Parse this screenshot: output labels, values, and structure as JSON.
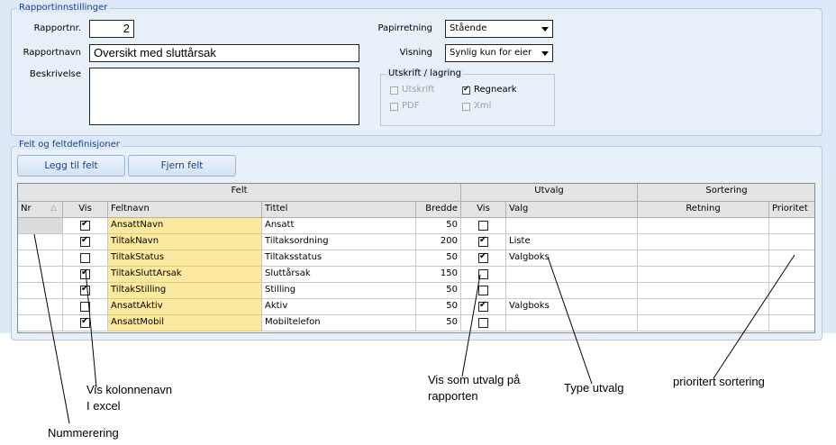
{
  "report_settings": {
    "title": "Rapportinnstillinger",
    "report_no_label": "Rapportnr.",
    "report_no_value": "2",
    "report_name_label": "Rapportnavn",
    "report_name_value": "Oversikt med sluttårsak",
    "description_label": "Beskrivelse",
    "description_value": "",
    "orientation_label": "Papirretning",
    "orientation_value": "Stående",
    "visibility_label": "Visning",
    "visibility_value": "Synlig kun for eier",
    "output": {
      "title": "Utskrift / lagring",
      "print_label": "Utskrift",
      "spreadsheet_label": "Regneark",
      "pdf_label": "PDF",
      "xml_label": "Xml"
    }
  },
  "fields": {
    "title": "Felt og feltdefinisjoner",
    "add_button": "Legg til felt",
    "remove_button": "Fjern felt",
    "grid": {
      "group_headers": {
        "felt": "Felt",
        "utvalg": "Utvalg",
        "sortering": "Sortering"
      },
      "columns": {
        "nr": "Nr",
        "vis": "Vis",
        "feltnavn": "Feltnavn",
        "tittel": "Tittel",
        "bredde": "Bredde",
        "utvalg_vis": "Vis",
        "valg": "Valg",
        "retning": "Retning",
        "prioritet": "Prioritet"
      },
      "rows": [
        {
          "vis": true,
          "feltnavn": "AnsattNavn",
          "tittel": "Ansatt",
          "bredde": "50",
          "utvalg_vis": false,
          "valg": ""
        },
        {
          "vis": true,
          "feltnavn": "TiltakNavn",
          "tittel": "Tiltaksordning",
          "bredde": "200",
          "utvalg_vis": true,
          "valg": "Liste"
        },
        {
          "vis": false,
          "feltnavn": "TiltakStatus",
          "tittel": "Tiltaksstatus",
          "bredde": "50",
          "utvalg_vis": true,
          "valg": "Valgboks"
        },
        {
          "vis": true,
          "feltnavn": "TiltakSluttArsak",
          "tittel": "Sluttårsak",
          "bredde": "150",
          "utvalg_vis": false,
          "valg": ""
        },
        {
          "vis": true,
          "feltnavn": "TiltakStilling",
          "tittel": "Stilling",
          "bredde": "50",
          "utvalg_vis": false,
          "valg": ""
        },
        {
          "vis": false,
          "feltnavn": "AnsattAktiv",
          "tittel": "Aktiv",
          "bredde": "50",
          "utvalg_vis": true,
          "valg": "Valgboks"
        },
        {
          "vis": true,
          "feltnavn": "AnsattMobil",
          "tittel": "Mobiltelefon",
          "bredde": "50",
          "utvalg_vis": false,
          "valg": ""
        }
      ]
    }
  },
  "annotations": {
    "vis_kolonne_line1": "Vis kolonnenavn",
    "vis_kolonne_line2": "I excel",
    "nummerering": "Nummerering",
    "vis_utvalg_line1": "Vis som utvalg på",
    "vis_utvalg_line2": "rapporten",
    "type_utvalg": "Type utvalg",
    "prioritert": "prioritert sortering"
  },
  "colors": {
    "panel_bg": "#dfe8f6",
    "title_blue": "#15428b",
    "feltnavn_highlight": "#fbe9a0"
  }
}
